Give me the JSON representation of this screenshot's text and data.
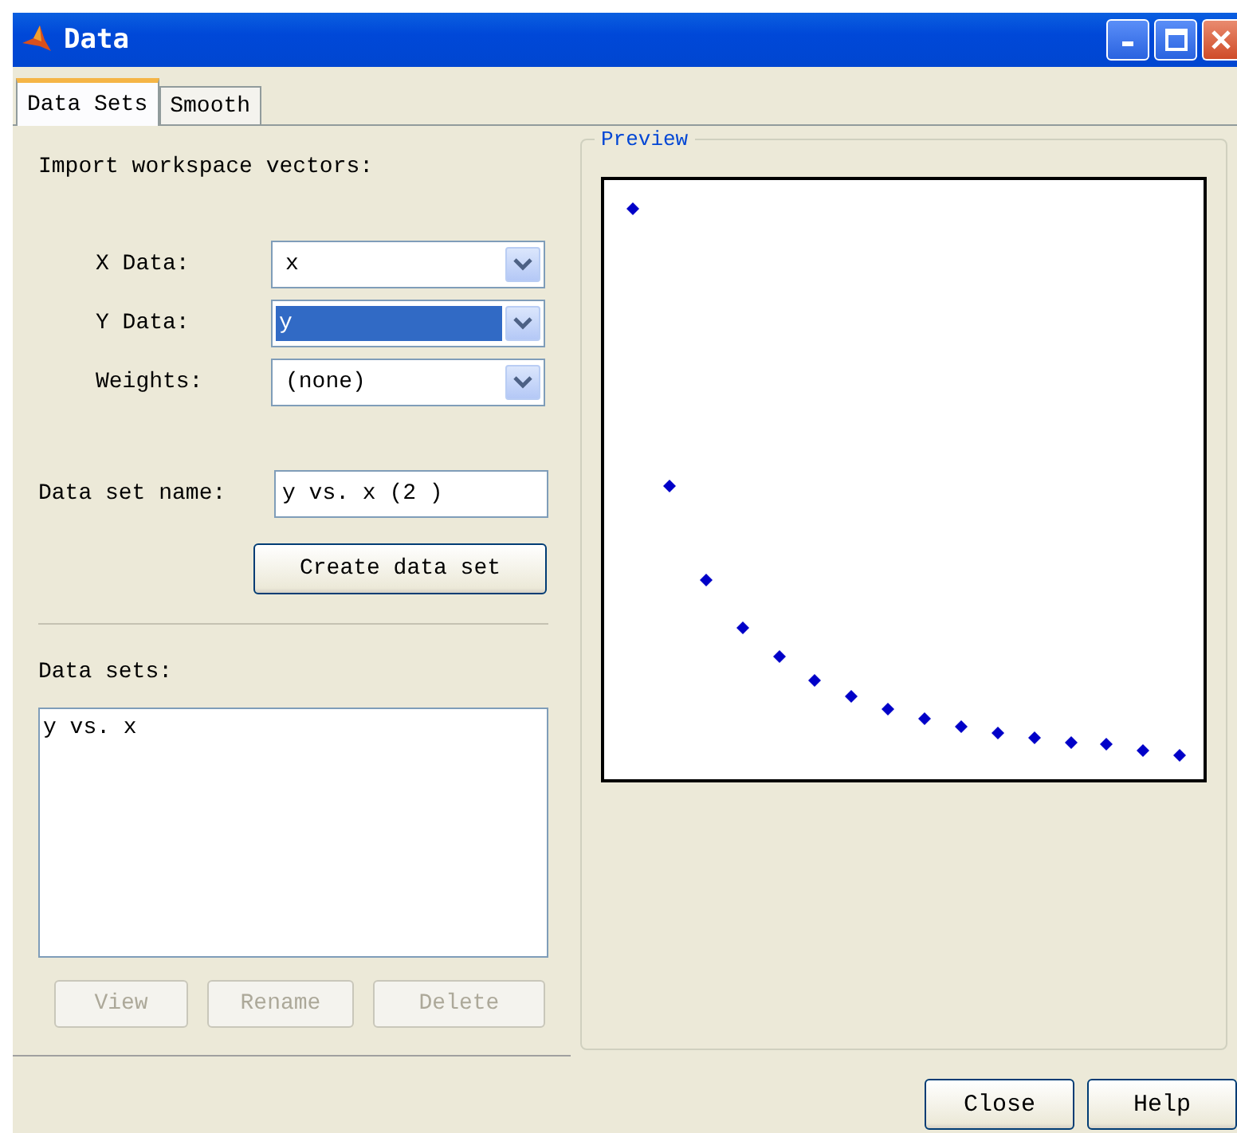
{
  "window": {
    "title": "Data"
  },
  "tabs": [
    {
      "label": "Data Sets",
      "selected": true
    },
    {
      "label": "Smooth",
      "selected": false
    }
  ],
  "import": {
    "heading": "Import workspace vectors:",
    "fields": [
      {
        "label": "X Data:",
        "value": "x",
        "focused": false
      },
      {
        "label": "Y Data:",
        "value": "y",
        "focused": true
      },
      {
        "label": "Weights:",
        "value": "(none)",
        "focused": false
      }
    ]
  },
  "name_field": {
    "label": "Data set name:",
    "value": "y vs. x (2 )"
  },
  "create_button": "Create data set",
  "data_sets": {
    "label": "Data sets:",
    "items": [
      "y vs. x"
    ],
    "buttons": [
      {
        "label": "View",
        "disabled": true
      },
      {
        "label": "Rename",
        "disabled": true
      },
      {
        "label": "Delete",
        "disabled": true
      }
    ]
  },
  "preview": {
    "title": "Preview"
  },
  "buttons": [
    "Close",
    "Help"
  ]
}
